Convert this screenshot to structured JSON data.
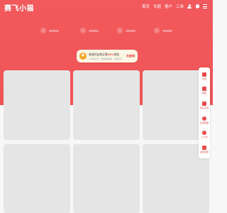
{
  "app": {
    "logo_text": "赛飞小猫"
  },
  "nav": {
    "items": [
      {
        "label": "首页"
      },
      {
        "label": "专题"
      },
      {
        "label": "客户"
      },
      {
        "label": "工单"
      }
    ]
  },
  "promo": {
    "coin_symbol": "¥",
    "line1_prefix": "邀请好友购买满",
    "line1_highlight": "30%",
    "line1_suffix": "佣金",
    "line2": "少年爱打卡 · 邀请码有效 · 立即分享",
    "button_label": "去邀请"
  },
  "sidebar": {
    "items": [
      {
        "label": "签到",
        "icon": "gift-icon"
      },
      {
        "label": "客服",
        "icon": "headset-icon"
      },
      {
        "label": "意见反馈",
        "icon": "edit-icon"
      },
      {
        "label": "在线客服",
        "icon": "support-icon"
      },
      {
        "label": "公众号",
        "icon": "wechat-icon"
      },
      {
        "label": "返回顶部",
        "icon": "arrow-up-icon"
      }
    ]
  },
  "colors": {
    "brand_red": "#f05456",
    "card_gray": "#e5e5e5",
    "accent_orange": "#f5a623"
  }
}
